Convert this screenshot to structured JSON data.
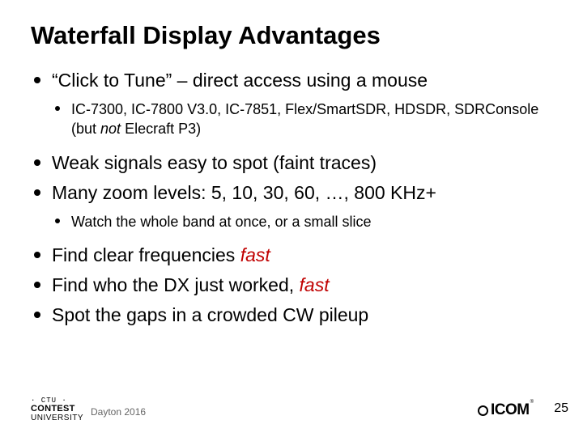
{
  "title": "Waterfall Display Advantages",
  "bullets": {
    "b0": "“Click to Tune” – direct access using a mouse",
    "b0_sub": "IC-7300, IC-7800 V3.0, IC-7851, Flex/SmartSDR, HDSDR, SDRConsole (but ",
    "b0_sub_not": "not",
    "b0_sub_tail": " Elecraft P3)",
    "b1": "Weak signals easy to spot (faint traces)",
    "b2": "Many zoom levels: 5, 10, 30, 60, …, 800 KHz+",
    "b2_sub": "Watch the whole band at once, or a small slice",
    "b3_a": "Find clear frequencies ",
    "b4_a": "Find who the DX just worked, ",
    "b5": "Spot the gaps in a crowded CW pileup",
    "fast": "fast"
  },
  "footer": {
    "ctu_line": "· CTU ·",
    "contest": "CONTEST",
    "university": "UNIVERSITY",
    "venue": "Dayton 2016",
    "icom": "ICOM",
    "reg": "®",
    "page": "25"
  }
}
